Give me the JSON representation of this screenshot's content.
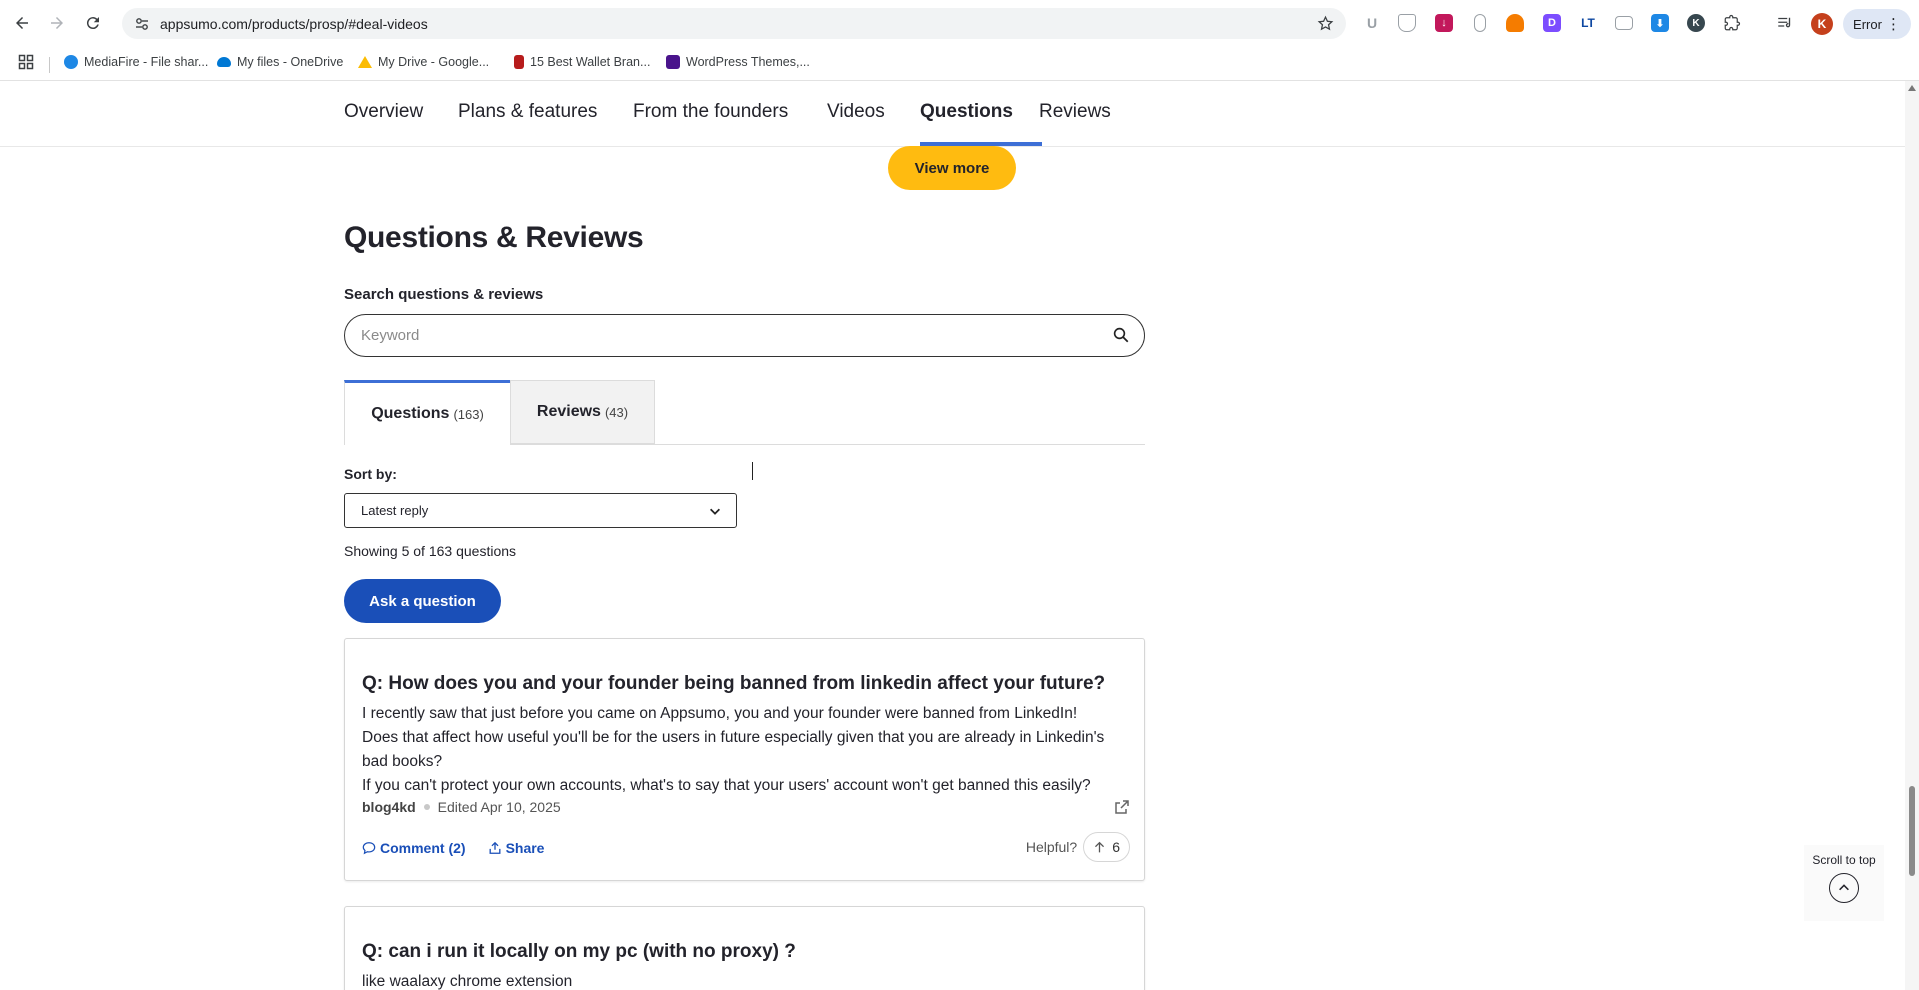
{
  "browser": {
    "url": "appsumo.com/products/prosp/#deal-videos",
    "error_label": "Error",
    "profile_initial": "K",
    "bookmarks": [
      {
        "label": "MediaFire - File shar...",
        "color": "#1e88e5"
      },
      {
        "label": "My files - OneDrive",
        "color": "#0078d4"
      },
      {
        "label": "My Drive - Google...",
        "color": "#fbbc04"
      },
      {
        "label": "15 Best Wallet Bran...",
        "color": "#b71c1c"
      },
      {
        "label": "WordPress Themes,...",
        "color": "#4a148c"
      }
    ]
  },
  "subnav": {
    "items": [
      "Overview",
      "Plans & features",
      "From the founders",
      "Videos",
      "Questions",
      "Reviews"
    ],
    "active": "Questions"
  },
  "view_more": "View more",
  "section": {
    "title": "Questions & Reviews",
    "search_label": "Search questions & reviews",
    "search_placeholder": "Keyword"
  },
  "tabs": [
    {
      "label": "Questions",
      "count": "(163)"
    },
    {
      "label": "Reviews",
      "count": "(43)"
    }
  ],
  "sort": {
    "label": "Sort by:",
    "value": "Latest reply"
  },
  "showing": "Showing 5 of 163 questions",
  "ask_button": "Ask a question",
  "questions": [
    {
      "title": "Q: How does you and your founder being banned from linkedin affect your future?",
      "body": [
        "I recently saw that just before you came on Appsumo, you and your founder were banned from LinkedIn!",
        "Does that affect how useful you'll be for the users in future especially given that you are already in Linkedin's bad books?",
        "If you can't protect your own accounts, what's to say that your users' account won't get banned this easily?"
      ],
      "author": "blog4kd",
      "date": "Edited Apr 10, 2025",
      "comment_label": "Comment (2)",
      "share_label": "Share",
      "helpful_label": "Helpful?",
      "votes": "6"
    },
    {
      "title": "Q: can i run it locally on my pc (with no proxy) ?",
      "body": [
        "like waalaxy chrome extension"
      ]
    }
  ],
  "scroll_top_label": "Scroll to top"
}
